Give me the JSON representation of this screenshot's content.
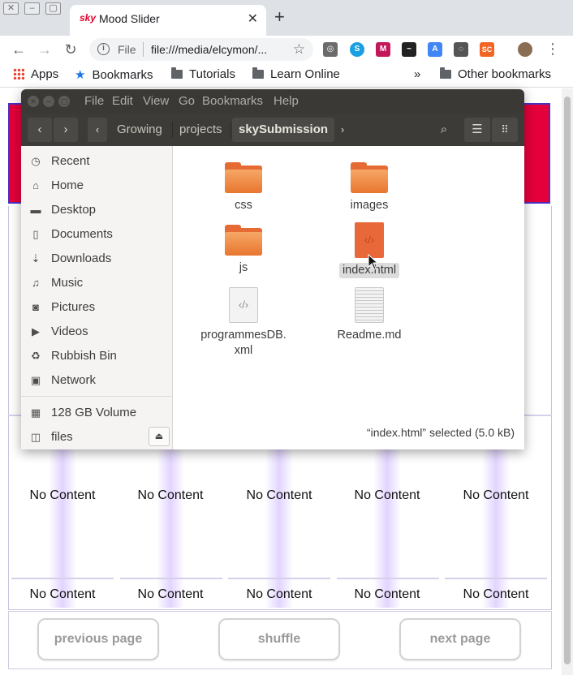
{
  "browser": {
    "tab": {
      "title": "Mood Slider",
      "favicon_text": "sky",
      "close": "✕"
    },
    "new_tab": "+",
    "window_buttons": [
      "✕",
      "–",
      "▢"
    ],
    "omnibox": {
      "scheme_label": "File",
      "url": "file:///media/elcymon/..."
    },
    "extensions": [
      {
        "name": "extension-film-reel-icon",
        "color": "#6b6b6b",
        "glyph": "◎"
      },
      {
        "name": "extension-skype-icon",
        "color": "#1a9fe0",
        "glyph": "S"
      },
      {
        "name": "extension-m-icon",
        "color": "#c2185b",
        "glyph": "M"
      },
      {
        "name": "extension-wave-icon",
        "color": "#222222",
        "glyph": "~"
      },
      {
        "name": "extension-translate-icon",
        "color": "#4285f4",
        "glyph": "A"
      },
      {
        "name": "extension-bulb-icon",
        "color": "#555555",
        "glyph": "◌"
      },
      {
        "name": "extension-sc-icon",
        "color": "#f26522",
        "glyph": "SC"
      }
    ],
    "bookmarks": {
      "apps": "Apps",
      "items": [
        "Bookmarks",
        "Tutorials",
        "Learn Online"
      ],
      "overflow": "»",
      "other": "Other bookmarks"
    }
  },
  "file_manager": {
    "window_controls": [
      "✕",
      "–",
      "▢"
    ],
    "menu": [
      "File",
      "Edit",
      "View",
      "Go",
      "Bookmarks",
      "Help"
    ],
    "path": [
      "Growing",
      "projects",
      "skySubmission"
    ],
    "sidebar": [
      {
        "label": "Recent",
        "icon": "◷",
        "name": "clock-icon"
      },
      {
        "label": "Home",
        "icon": "⌂",
        "name": "home-icon"
      },
      {
        "label": "Desktop",
        "icon": "▬",
        "name": "desktop-folder-icon"
      },
      {
        "label": "Documents",
        "icon": "▯",
        "name": "document-icon"
      },
      {
        "label": "Downloads",
        "icon": "⇣",
        "name": "download-icon"
      },
      {
        "label": "Music",
        "icon": "♫",
        "name": "music-icon"
      },
      {
        "label": "Pictures",
        "icon": "◙",
        "name": "camera-icon"
      },
      {
        "label": "Videos",
        "icon": "▶",
        "name": "video-icon"
      },
      {
        "label": "Rubbish Bin",
        "icon": "♻",
        "name": "trash-icon"
      },
      {
        "label": "Network",
        "icon": "▣",
        "name": "network-icon"
      }
    ],
    "devices": [
      {
        "label": "128 GB Volume",
        "icon": "▦",
        "name": "drive-icon"
      },
      {
        "label": "files",
        "icon": "◫",
        "name": "drive-icon"
      }
    ],
    "files": [
      {
        "label": "css",
        "type": "folder"
      },
      {
        "label": "images",
        "type": "folder"
      },
      {
        "label": "js",
        "type": "folder"
      },
      {
        "label": "index.html",
        "type": "html",
        "selected": true
      },
      {
        "label_line1": "programmesDB.",
        "label_line2": "xml",
        "type": "xml"
      },
      {
        "label": "Readme.md",
        "type": "text"
      }
    ],
    "status": "“index.html” selected  (5.0 kB)"
  },
  "page": {
    "grid_row_1": [
      "No Content",
      "No Content",
      "No Content",
      "No Content",
      "No Content"
    ],
    "grid_row_2": [
      "No Content",
      "No Content",
      "No Content",
      "No Content",
      "No Content"
    ],
    "buttons": {
      "previous": "previous page",
      "shuffle": "shuffle",
      "next": "next page"
    },
    "colors": {
      "banner": "#e4003b",
      "banner_border": "#4c2fbf",
      "mood_gradient": "#e2d4ff"
    }
  }
}
